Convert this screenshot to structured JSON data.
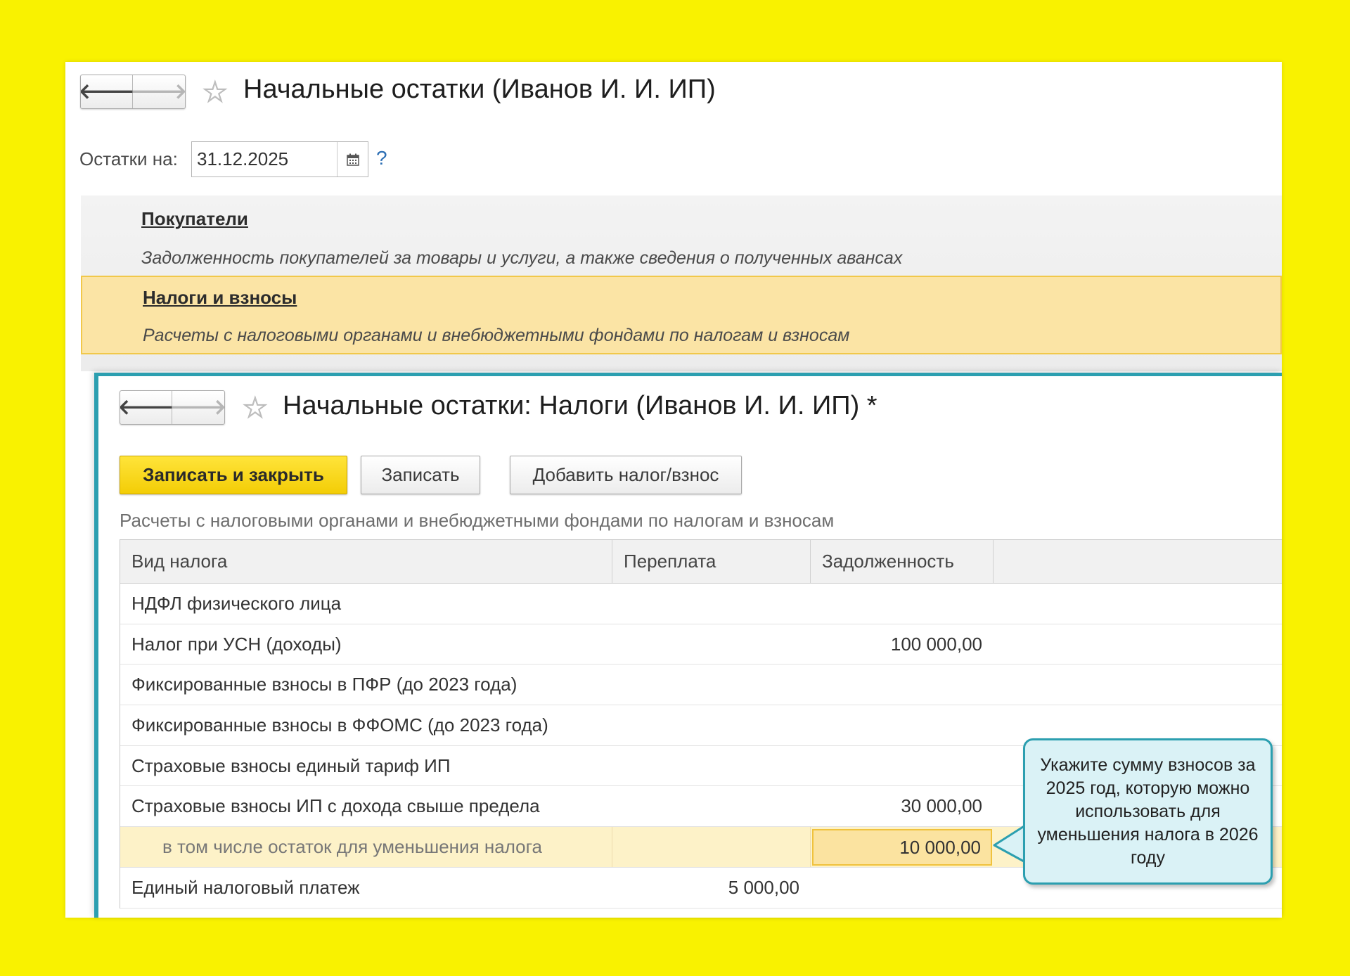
{
  "back_window": {
    "title": "Начальные остатки (Иванов И. И. ИП)",
    "nav": {
      "back_icon": "arrow-left-icon",
      "forward_icon": "arrow-right-icon"
    },
    "date_label": "Остатки на:",
    "date_value": "31.12.2025",
    "help_label": "?",
    "sections": [
      {
        "title": "Покупатели",
        "description": "Задолженность покупателей за товары и услуги, а также сведения о полученных авансах"
      },
      {
        "title": "Налоги и взносы",
        "description": "Расчеты с налоговыми органами и внебюджетными фондами по налогам и взносам"
      }
    ]
  },
  "front_window": {
    "title": "Начальные остатки: Налоги (Иванов И. И. ИП) *",
    "buttons": {
      "save_close": "Записать и закрыть",
      "save": "Записать",
      "add_tax": "Добавить налог/взнос"
    },
    "description": "Расчеты с налоговыми органами и внебюджетными фондами по налогам и взносам",
    "table": {
      "columns": [
        "Вид налога",
        "Переплата",
        "Задолженность"
      ],
      "rows": [
        {
          "name": "НДФЛ физического лица",
          "overpayment": "",
          "debt": ""
        },
        {
          "name": "Налог при УСН (доходы)",
          "overpayment": "",
          "debt": "100 000,00"
        },
        {
          "name": "Фиксированные взносы в ПФР (до 2023 года)",
          "overpayment": "",
          "debt": ""
        },
        {
          "name": "Фиксированные взносы в ФФОМС (до 2023 года)",
          "overpayment": "",
          "debt": ""
        },
        {
          "name": "Страховые взносы единый тариф ИП",
          "overpayment": "",
          "debt": ""
        },
        {
          "name": "Страховые взносы ИП с дохода свыше предела",
          "overpayment": "",
          "debt": "30 000,00"
        },
        {
          "name": "в том числе остаток для уменьшения налога",
          "overpayment": "",
          "debt": "10 000,00"
        },
        {
          "name": "Единый налоговый платеж",
          "overpayment": "5 000,00",
          "debt": ""
        }
      ]
    }
  },
  "callout": {
    "text": "Укажите сумму взносов за 2025 год, которую можно использовать для уменьшения налога в 2026 году"
  },
  "colors": {
    "background": "#f9f200",
    "accent": "#2c9fb0",
    "primary_button": "#f3cd06",
    "highlight": "#fbe4a5"
  }
}
